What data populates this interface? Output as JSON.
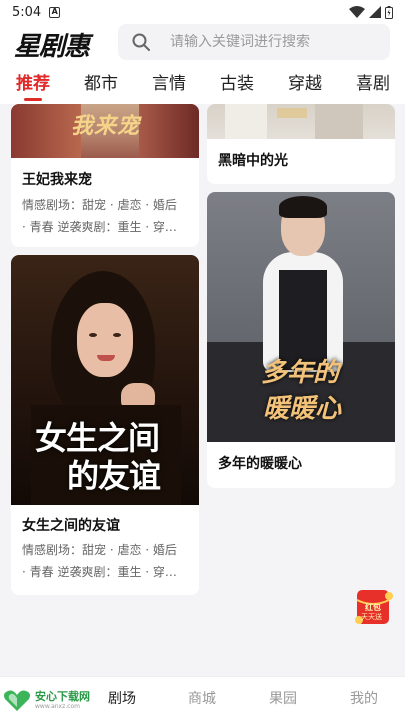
{
  "status_bar": {
    "time": "5:04",
    "notification_letter": "A"
  },
  "header": {
    "logo_text": "星剧惠",
    "search_placeholder": "请输入关键词进行搜索"
  },
  "tabs": [
    {
      "label": "推荐",
      "active": true
    },
    {
      "label": "都市",
      "active": false
    },
    {
      "label": "言情",
      "active": false
    },
    {
      "label": "古装",
      "active": false
    },
    {
      "label": "穿越",
      "active": false
    },
    {
      "label": "喜剧",
      "active": false
    }
  ],
  "cards": [
    {
      "title": "王妃我来宠",
      "desc_line1": "情感剧场：甜宠 · 虐恋 · 婚后",
      "desc_line2": "· 青春 逆袭爽剧：重生 · 穿…",
      "poster_text": "我来宠"
    },
    {
      "title": "黑暗中的光"
    },
    {
      "title": "女生之间的友谊",
      "desc_line1": "情感剧场：甜宠 · 虐恋 · 婚后",
      "desc_line2": "· 青春 逆袭爽剧：重生 · 穿…",
      "poster_text_line1": "女生之间",
      "poster_text_line2": "的友谊"
    },
    {
      "title": "多年的暖暖心",
      "poster_text_line1": "多年的",
      "poster_text_line2": "暖暖心"
    }
  ],
  "float_badge": {
    "line1": "红包",
    "line2": "天天送"
  },
  "bottom_nav": {
    "watermark_title": "安心下载网",
    "watermark_sub": "www.anxz.com",
    "items": [
      {
        "label": "剧场",
        "active": true
      },
      {
        "label": "商城",
        "active": false
      },
      {
        "label": "果园",
        "active": false
      },
      {
        "label": "我的",
        "active": false
      }
    ]
  },
  "colors": {
    "accent": "#e02a2a",
    "background": "#f4f4f6",
    "watermark_green": "#2a9a47"
  }
}
